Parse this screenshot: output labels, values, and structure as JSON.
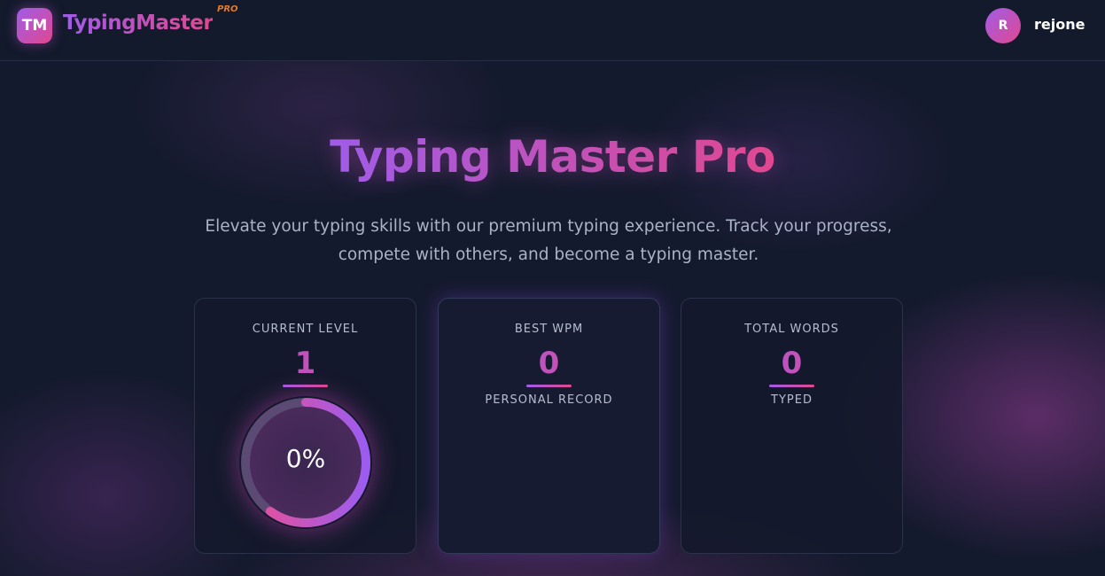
{
  "header": {
    "logo_badge": "TM",
    "logo_text": "TypingMaster",
    "logo_pro": "PRO",
    "avatar_initial": "R",
    "username": "rejone"
  },
  "hero": {
    "title": "Typing Master Pro",
    "subtitle": "Elevate your typing skills with our premium typing experience. Track your progress, compete with others, and become a typing master."
  },
  "stats": {
    "level": {
      "label": "CURRENT LEVEL",
      "value": "1",
      "progress_text": "0%",
      "progress_fraction": 0.6
    },
    "wpm": {
      "label": "BEST WPM",
      "value": "0",
      "sub": "PERSONAL RECORD"
    },
    "words": {
      "label": "TOTAL WORDS",
      "value": "0",
      "sub": "TYPED"
    }
  },
  "colors": {
    "accent_start": "#a05ce8",
    "accent_end": "#e0488f",
    "background": "#141a2e"
  }
}
